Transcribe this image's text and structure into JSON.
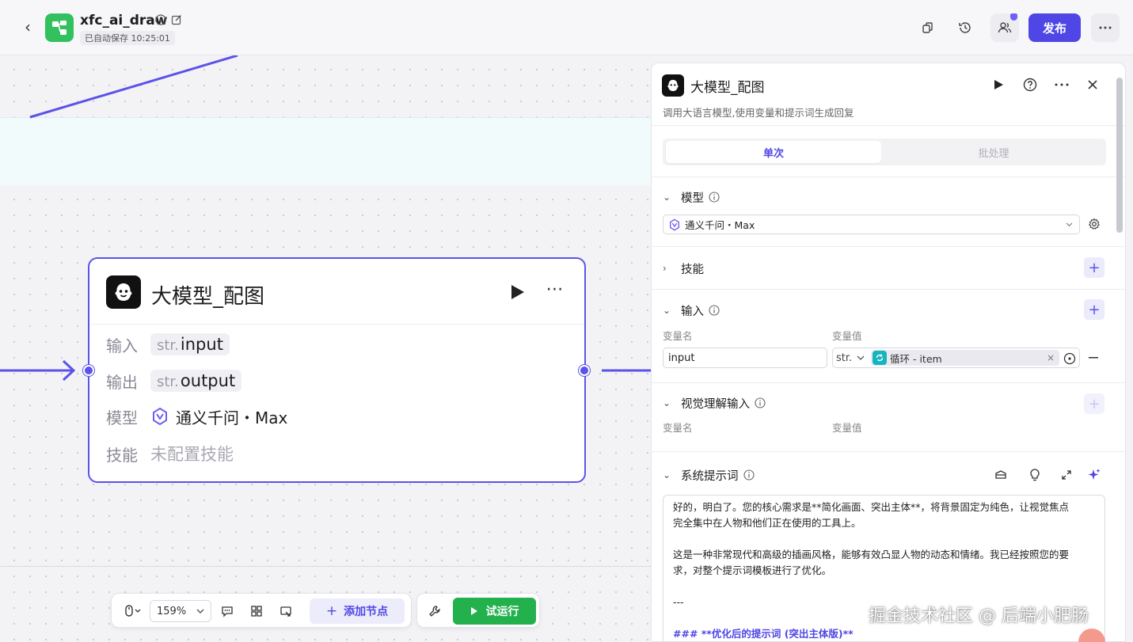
{
  "header": {
    "app_name": "xfc_ai_draw",
    "autosave": "已自动保存 10:25:01",
    "publish_label": "发布"
  },
  "canvas": {
    "node": {
      "title": "大模型_配图",
      "input_label": "输入",
      "input_type": "str.",
      "input_name": "input",
      "output_label": "输出",
      "output_type": "str.",
      "output_name": "output",
      "model_label": "模型",
      "model_value": "通义千问・Max",
      "skill_label": "技能",
      "skill_value": "未配置技能"
    }
  },
  "toolbar": {
    "zoom": "159%",
    "add_node": "添加节点",
    "trial_run": "试运行"
  },
  "panel": {
    "title": "大模型_配图",
    "description": "调用大语言模型,使用变量和提示词生成回复",
    "tabs": [
      {
        "label": "单次",
        "active": true
      },
      {
        "label": "批处理",
        "active": false
      }
    ],
    "model_section": {
      "title": "模型",
      "selected": "通义千问・Max"
    },
    "skills_section": {
      "title": "技能"
    },
    "input_section": {
      "title": "输入",
      "col_name": "变量名",
      "col_value": "变量值",
      "var_name": "input",
      "var_type": "str.",
      "ref_label": "循环 - item"
    },
    "vision_section": {
      "title": "视觉理解输入",
      "col_name": "变量名",
      "col_value": "变量值"
    },
    "prompt_section": {
      "title": "系统提示词",
      "lines": [
        "好的，明白了。您的核心需求是**简化画面、突出主体**，将背景固定为纯色，让视觉焦点",
        "完全集中在人物和他们正在使用的工具上。",
        "",
        "这是一种非常现代和高级的插画风格，能够有效凸显人物的动态和情绪。我已经按照您的要",
        "求，对整个提示词模板进行了优化。",
        "",
        "---",
        "",
        "### **优化后的提示词 (突出主体版)**"
      ]
    }
  },
  "watermark": "掘金技术社区 @ 后端小肥肠",
  "colors": {
    "accent": "#4e46e5",
    "run_green": "#22b14c",
    "logo_green": "#33c05f",
    "loop_teal": "#15b5bf"
  }
}
